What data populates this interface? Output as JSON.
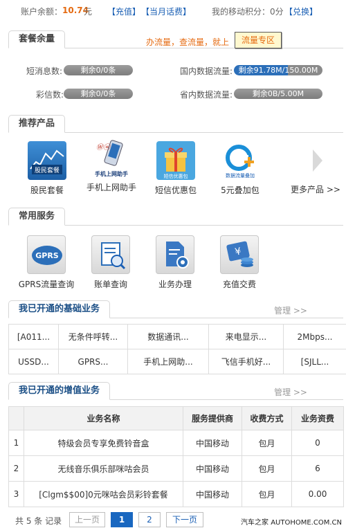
{
  "account": {
    "balance_label": "账户余额：",
    "balance_value": "10.74",
    "balance_unit": "元",
    "recharge_link": "【充值】",
    "monthly_bill_link": "【当月话费】",
    "points_text": "我的移动积分：0分",
    "redeem_link": "【兑换】"
  },
  "quota": {
    "title": "套餐余量",
    "promo_text": "办流量，查流量，就上",
    "flow_zone_button": "流量专区",
    "sms_label": "短消息数:",
    "sms_value": "剩余0/0条",
    "mms_label": "彩信数:",
    "mms_value": "剩余0/0条",
    "domestic_label": "国内数据流量:",
    "domestic_value": "剩余91.78M/150.00M",
    "domestic_fraction": 0.61,
    "provincial_label": "省内数据流量:",
    "provincial_value": "剩余0B/5.00M"
  },
  "recommended": {
    "title": "推荐产品",
    "items": [
      {
        "label": "股民套餐",
        "icon": "stock-chart-icon",
        "caption": "股民套餐"
      },
      {
        "label": "手机上网助手",
        "icon": "phone-internet-icon",
        "caption": "手机上网助手"
      },
      {
        "label": "短信优惠包",
        "icon": "gift-box-icon",
        "caption": "短信优惠包"
      },
      {
        "label": "5元叠加包",
        "icon": "data-addon-icon",
        "caption": "数据流量叠加"
      }
    ],
    "more_label": "更多产品 >>"
  },
  "services": {
    "title": "常用服务",
    "items": [
      {
        "label": "GPRS流量查询",
        "icon": "gprs-icon",
        "caption": "GPRS"
      },
      {
        "label": "账单查询",
        "icon": "bill-search-icon"
      },
      {
        "label": "业务办理",
        "icon": "document-gear-icon"
      },
      {
        "label": "充值交费",
        "icon": "money-coins-icon"
      }
    ]
  },
  "basic_services": {
    "title": "我已开通的基础业务",
    "manage_link": "管理 >>",
    "rows": [
      [
        "[A011...",
        "无条件呼转...",
        "数据通讯...",
        "来电显示...",
        "2Mbps..."
      ],
      [
        "USSD...",
        "GPRS...",
        "手机上网助...",
        "飞信手机好...",
        "[SJLL..."
      ]
    ]
  },
  "value_added": {
    "title": "我已开通的增值业务",
    "manage_link": "管理 >>",
    "headers": [
      "",
      "业务名称",
      "服务提供商",
      "收费方式",
      "业务资费"
    ],
    "rows": [
      [
        "1",
        "特级会员专享免费铃音盒",
        "中国移动",
        "包月",
        "0"
      ],
      [
        "2",
        "无线音乐俱乐部咪咕会员",
        "中国移动",
        "包月",
        "6"
      ],
      [
        "3",
        "[Clgm$$00]0元咪咕会员彩铃套餐",
        "中国移动",
        "包月",
        "0.00"
      ]
    ]
  },
  "pagination": {
    "summary": "共 5 条 记录",
    "prev": "上一页",
    "page1": "1",
    "page2": "2",
    "next": "下一页"
  },
  "watermark": "汽车之家 AUTOHOME.COM.CN",
  "colors": {
    "accent_orange": "#e56a10",
    "link_blue": "#1a5fb4",
    "pill_blue": "#2c6fb9"
  }
}
